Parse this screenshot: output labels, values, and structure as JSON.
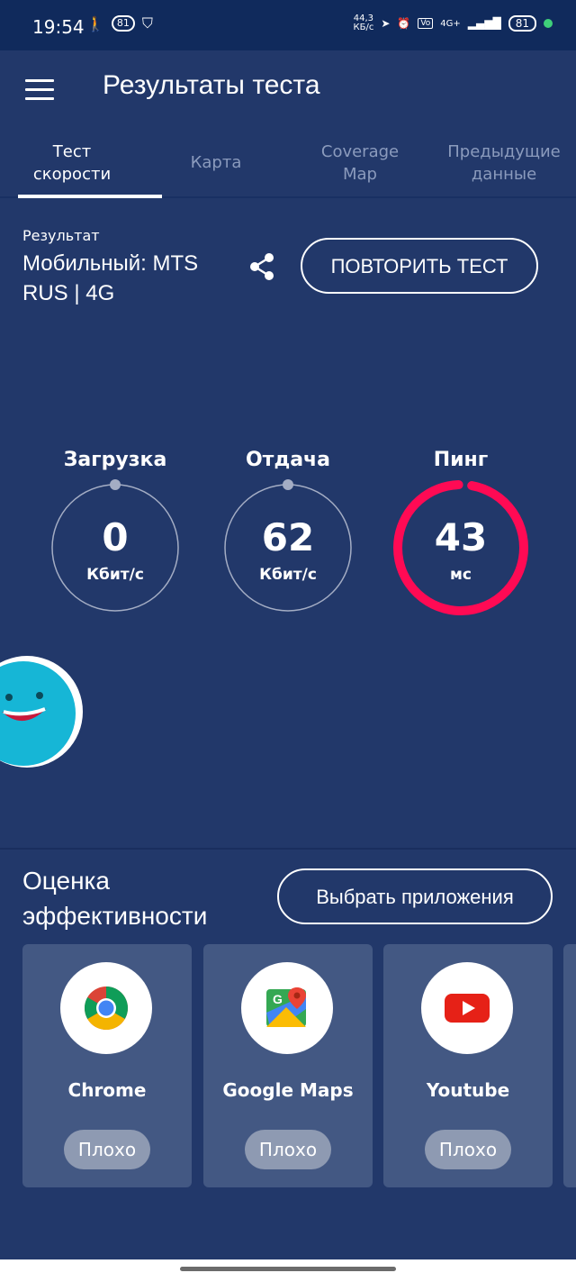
{
  "status_bar": {
    "time": "19:54",
    "notif_badge": "81",
    "net_speed_value": "44,3",
    "net_speed_unit": "КБ/с",
    "network": "4G+",
    "battery": "81",
    "icons": [
      "walk-icon",
      "shield-icon",
      "location-arrow-icon",
      "alarm-icon",
      "volte-icon",
      "signal-icon",
      "battery-icon"
    ]
  },
  "appbar": {
    "title": "Результаты теста"
  },
  "tabs": [
    {
      "label": "Тест скорости",
      "active": true
    },
    {
      "label": "Карта",
      "active": false
    },
    {
      "label": "Coverage Map",
      "active": false
    },
    {
      "label": "Предыдущие данные",
      "active": false
    }
  ],
  "result": {
    "label": "Результат",
    "value": "Мобильный: MTS RUS | 4G",
    "retest_label": "ПОВТОРИТЬ ТЕСТ"
  },
  "gauges": [
    {
      "label": "Загрузка",
      "value": "0",
      "unit": "Кбит/с",
      "progress": 0
    },
    {
      "label": "Отдача",
      "value": "62",
      "unit": "Кбит/с",
      "progress": 0
    },
    {
      "label": "Пинг",
      "value": "43",
      "unit": "мс",
      "progress": 0.97
    }
  ],
  "performance": {
    "title": "Оценка эффективности",
    "choose_label": "Выбрать приложения",
    "apps": [
      {
        "name": "Chrome",
        "rating": "Плохо",
        "icon": "chrome-icon"
      },
      {
        "name": "Google Maps",
        "rating": "Плохо",
        "icon": "google-maps-icon"
      },
      {
        "name": "Youtube",
        "rating": "Плохо",
        "icon": "youtube-icon"
      }
    ]
  },
  "colors": {
    "background": "#22386a",
    "status_bar": "#102a5c",
    "card": "#435883",
    "ping_accent": "#ff0a54",
    "badge": "#8e9ab2"
  }
}
